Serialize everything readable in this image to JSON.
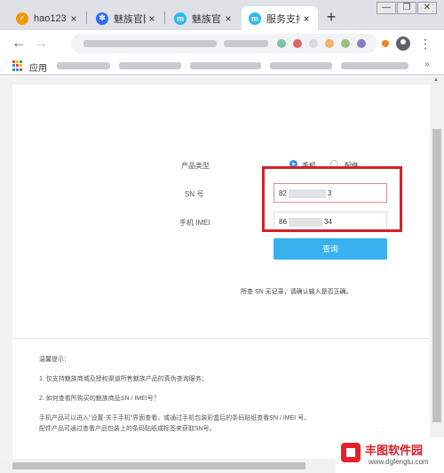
{
  "browser": {
    "tabs": [
      {
        "label": "hao123",
        "icon": "hao123-icon",
        "color": "#f39800"
      },
      {
        "label": "魅族官网",
        "icon": "baidu-paw-icon",
        "color": "#2b6ff7"
      },
      {
        "label": "魅族官网",
        "icon": "meizu-m-icon",
        "color": "#2db7f5"
      },
      {
        "label": "服务支持",
        "icon": "meizu-m-icon",
        "color": "#2db7f5",
        "active": true
      }
    ],
    "tab_close_glyph": "×",
    "new_tab_glyph": "+",
    "window_controls": [
      "—",
      "❐",
      "✕"
    ],
    "back_glyph": "←",
    "forward_glyph": "→",
    "menu_glyph": "⋮",
    "bookmarks": {
      "apps_label": "应用",
      "more_glyph": "»"
    }
  },
  "form": {
    "product_type_label": "产品类型",
    "product_type_options": [
      {
        "label": "手机",
        "selected": true
      },
      {
        "label": "配件",
        "selected": false
      }
    ],
    "sn_label": "SN 号",
    "sn_value_start": "82",
    "sn_value_end": "3",
    "imei_label": "手机 IMEI",
    "imei_value_start": "86",
    "imei_value_end": "34",
    "query_button": "查询",
    "result_message": "所查 SN 无记录，请确认输入是否正确。"
  },
  "tips": {
    "title": "温馨提示：",
    "items": [
      "1. 仅支持魅族商城及授权渠道所售魅族产品的真伪查询服务；",
      "2. 如何查看所购买的魅族商品SN / IMEI号？",
      "手机产品可以进入\"设置-关于手机\"界面查看，或通过手机包装彩盒后的条码贴纸查看SN / IMEI 号。",
      "配件产品可通过查看产品包装上的条码贴纸或标签来获取SN号。"
    ]
  },
  "watermark": {
    "title": "丰图软件园",
    "url": "www.dgfengtu.com"
  },
  "colors": {
    "accent": "#2d8cf0",
    "button": "#39b1ef",
    "highlight": "#d6202c"
  }
}
